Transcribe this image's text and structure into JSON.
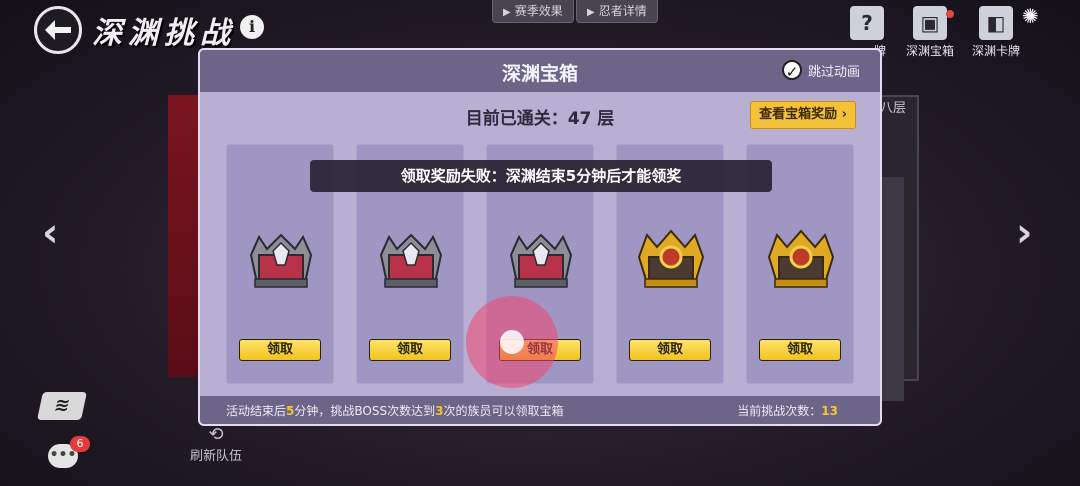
{
  "header": {
    "title": "深渊挑战",
    "info_glyph": "i",
    "tabs": [
      "赛季效果",
      "忍者详情"
    ],
    "right_items": [
      {
        "label": "牌",
        "icon": "?"
      },
      {
        "label": "深渊宝箱",
        "icon": "▣"
      },
      {
        "label": "深渊卡牌",
        "icon": "◧"
      }
    ]
  },
  "background": {
    "card_label": "八层"
  },
  "modal": {
    "title": "深渊宝箱",
    "skip_label": "跳过动画",
    "skip_checked": true,
    "floor_text": "目前已通关：47 层",
    "reward_button": "查看宝箱奖励",
    "toast": "领取奖励失败：深渊结束5分钟后才能领奖",
    "chests": [
      {
        "type": "silver",
        "button": "领取"
      },
      {
        "type": "silver",
        "button": "领取"
      },
      {
        "type": "silver",
        "button": "领取"
      },
      {
        "type": "gold",
        "button": "领取"
      },
      {
        "type": "gold",
        "button": "领取"
      }
    ],
    "footer": {
      "part1": "活动结束后",
      "minutes": "5",
      "part2": "分钟，挑战BOSS次数达到",
      "times": "3",
      "part3": "次的族员可以领取宝箱",
      "count_label": "当前挑战次数：",
      "count_value": "13"
    }
  },
  "left_bottom": {
    "chat_badge": "6",
    "refresh_label": "刷新队伍"
  },
  "colors": {
    "gold": "#f3c23a",
    "highlight": "#f6c531",
    "panel": "#b8afd3",
    "header": "#6d6588"
  }
}
